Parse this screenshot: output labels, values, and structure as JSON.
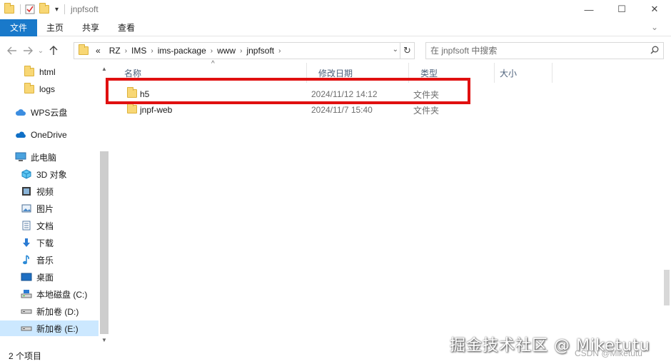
{
  "window": {
    "title": "jnpfsoft",
    "controls": {
      "minimize": "—",
      "maximize": "☐",
      "close": "✕"
    }
  },
  "ribbon": {
    "file_tab": "文件",
    "tabs": [
      "主页",
      "共享",
      "查看"
    ]
  },
  "address": {
    "prefix": "«",
    "crumbs": [
      "RZ",
      "IMS",
      "ims-package",
      "www",
      "jnpfsoft"
    ]
  },
  "search": {
    "placeholder": "在 jnpfsoft 中搜索"
  },
  "sidebar": {
    "items": [
      {
        "label": "html",
        "icon": "folder-icon"
      },
      {
        "label": "logs",
        "icon": "folder-icon"
      },
      {
        "label": "WPS云盘",
        "icon": "cloud-icon"
      },
      {
        "label": "OneDrive",
        "icon": "onedrive-icon"
      },
      {
        "label": "此电脑",
        "icon": "computer-icon"
      },
      {
        "label": "3D 对象",
        "icon": "cube-icon"
      },
      {
        "label": "视频",
        "icon": "video-icon"
      },
      {
        "label": "图片",
        "icon": "picture-icon"
      },
      {
        "label": "文档",
        "icon": "document-icon"
      },
      {
        "label": "下载",
        "icon": "download-icon"
      },
      {
        "label": "音乐",
        "icon": "music-icon"
      },
      {
        "label": "桌面",
        "icon": "desktop-icon"
      },
      {
        "label": "本地磁盘 (C:)",
        "icon": "drive-c-icon"
      },
      {
        "label": "新加卷 (D:)",
        "icon": "drive-icon"
      },
      {
        "label": "新加卷 (E:)",
        "icon": "drive-icon"
      }
    ],
    "selected": "新加卷 (E:)"
  },
  "columns": [
    "名称",
    "修改日期",
    "类型",
    "大小"
  ],
  "files": [
    {
      "name": "h5",
      "date": "2024/11/12 14:12",
      "type": "文件夹",
      "highlighted": true
    },
    {
      "name": "jnpf-web",
      "date": "2024/11/7 15:40",
      "type": "文件夹",
      "highlighted": false
    }
  ],
  "status": {
    "count": "2 个项目"
  },
  "watermark": {
    "main": "掘金技术社区 @ Miketutu",
    "sub": "CSDN @Miketutu"
  },
  "colors": {
    "accent": "#1979ca",
    "highlight_box": "#e01010",
    "selected_bg": "#cce8ff"
  }
}
